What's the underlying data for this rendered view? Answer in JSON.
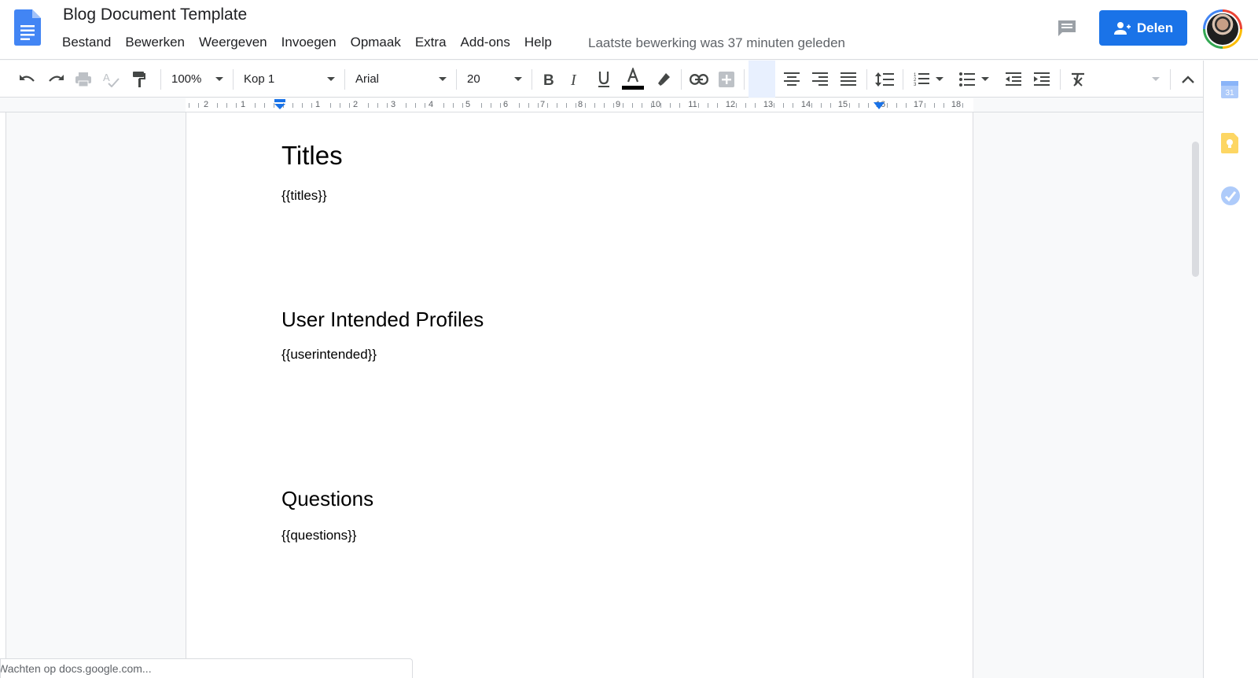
{
  "app": {
    "doc_title": "Blog Document Template",
    "last_edit": "Laatste bewerking was 37 minuten geleden",
    "share_label": "Delen",
    "accent_color": "#1a73e8"
  },
  "menu": {
    "items": [
      {
        "label": "Bestand"
      },
      {
        "label": "Bewerken"
      },
      {
        "label": "Weergeven"
      },
      {
        "label": "Invoegen"
      },
      {
        "label": "Opmaak"
      },
      {
        "label": "Extra"
      },
      {
        "label": "Add-ons"
      },
      {
        "label": "Help"
      }
    ]
  },
  "toolbar": {
    "zoom": "100%",
    "style": "Kop 1",
    "font": "Arial",
    "font_size": "20",
    "icons": [
      "undo-icon",
      "redo-icon",
      "print-icon",
      "spellcheck-icon",
      "paint-format-icon",
      "bold-icon",
      "italic-icon",
      "underline-icon",
      "text-color-icon",
      "highlight-icon",
      "link-icon",
      "comment-add-icon",
      "align-left-icon",
      "align-center-icon",
      "align-right-icon",
      "align-justify-icon",
      "line-spacing-icon",
      "numbered-list-icon",
      "bulleted-list-icon",
      "decrease-indent-icon",
      "increase-indent-icon",
      "clear-formatting-icon",
      "collapse-icon"
    ]
  },
  "ruler": {
    "labels": [
      "2",
      "1",
      "1",
      "2",
      "3",
      "4",
      "5",
      "6",
      "7",
      "8",
      "9",
      "10",
      "11",
      "12",
      "13",
      "14",
      "15",
      "16",
      "17",
      "18"
    ]
  },
  "document": {
    "sections": [
      {
        "heading": "Titles",
        "placeholder": "{{titles}}"
      },
      {
        "heading": "User Intended Profiles",
        "placeholder": "{{userintended}}"
      },
      {
        "heading": "Questions",
        "placeholder": "{{questions}}"
      }
    ]
  },
  "side_panel": {
    "icons": [
      "calendar-icon",
      "keep-icon",
      "tasks-icon"
    ],
    "calendar_day": "31"
  },
  "status": {
    "text": "Wachten op docs.google.com..."
  }
}
